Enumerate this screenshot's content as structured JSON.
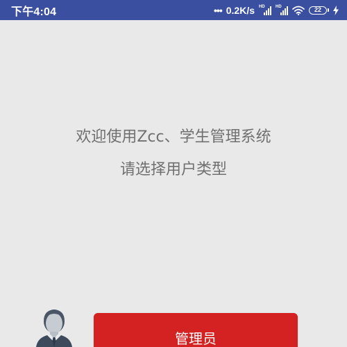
{
  "status_bar": {
    "time": "下午4:04",
    "network_speed": "0.2K/s",
    "signal_labels": [
      "HD",
      "HD"
    ],
    "battery_level": "22",
    "icons": [
      "more-dots-icon",
      "signal-icon",
      "signal-icon",
      "wifi-icon",
      "battery-icon",
      "charging-bolt-icon"
    ]
  },
  "main": {
    "welcome_text": "欢迎使用Zcc、学生管理系统",
    "subtitle_text": "请选择用户类型"
  },
  "user_types": [
    {
      "label": "管理员",
      "icon": "admin-avatar-icon"
    }
  ],
  "colors": {
    "status_bar": "#3a4fa0",
    "background": "#e9e9e9",
    "button": "#d42222",
    "text": "#707070"
  }
}
